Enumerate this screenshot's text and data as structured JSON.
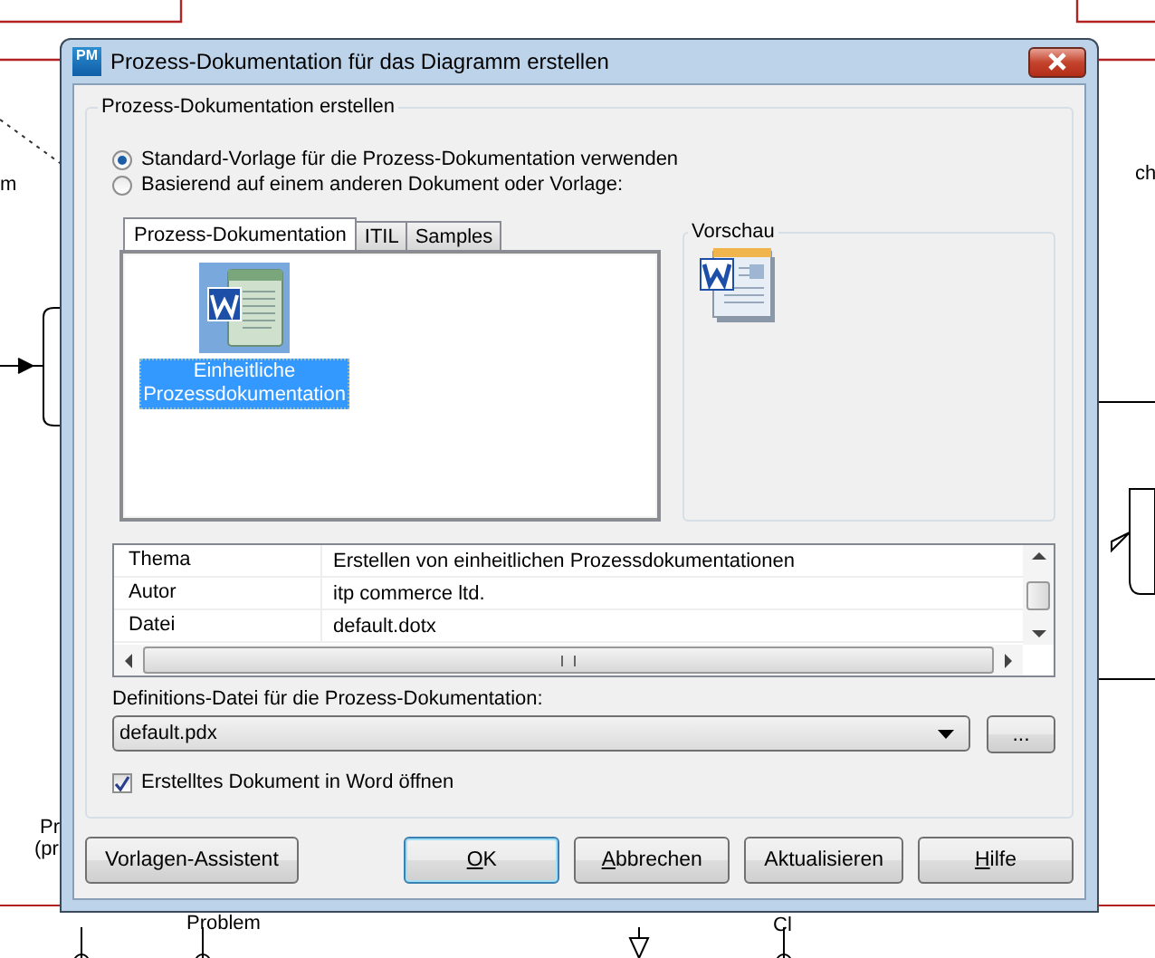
{
  "background": {
    "labels": [
      {
        "text": "m"
      },
      {
        "text": "ch"
      },
      {
        "text": "Pr"
      },
      {
        "text": "(pr"
      },
      {
        "text": "Problem"
      },
      {
        "text": "Cl"
      }
    ]
  },
  "dialog": {
    "title": "Prozess-Dokumentation für das Diagramm erstellen",
    "app_badge": "PM",
    "group_title": "Prozess-Dokumentation erstellen",
    "options": [
      {
        "label": "Standard-Vorlage für die Prozess-Dokumentation verwenden",
        "selected": true
      },
      {
        "label": "Basierend auf einem anderen Dokument oder Vorlage:",
        "selected": false
      }
    ],
    "tabs": [
      {
        "label": "Prozess-Dokumentation",
        "selected": true
      },
      {
        "label": "ITIL",
        "selected": false
      },
      {
        "label": "Samples",
        "selected": false
      }
    ],
    "templates": [
      {
        "label": "Einheitliche Prozessdokumentation",
        "selected": true
      }
    ],
    "preview_title": "Vorschau",
    "properties": [
      {
        "name": "Thema",
        "value": "Erstellen von einheitlichen Prozessdokumentationen"
      },
      {
        "name": "Autor",
        "value": "itp commerce ltd."
      },
      {
        "name": "Datei",
        "value": "default.dotx"
      }
    ],
    "definition_label": "Definitions-Datei für die Prozess-Dokumentation:",
    "definition_value": "default.pdx",
    "browse_button": "...",
    "open_in_word": {
      "label": "Erstelltes Dokument in Word öffnen",
      "checked": true
    },
    "buttons": [
      {
        "label": "Vorlagen-Assistent",
        "kind": "left",
        "underlined_initial": false,
        "focused": false
      },
      {
        "label": "OK",
        "kind": "right",
        "underlined_initial": true,
        "focused": true
      },
      {
        "label": "Abbrechen",
        "kind": "right",
        "underlined_initial": true,
        "focused": false
      },
      {
        "label": "Aktualisieren",
        "kind": "right",
        "underlined_initial": false,
        "focused": false
      },
      {
        "label": "Hilfe",
        "kind": "right",
        "underlined_initial": true,
        "focused": false
      }
    ]
  }
}
